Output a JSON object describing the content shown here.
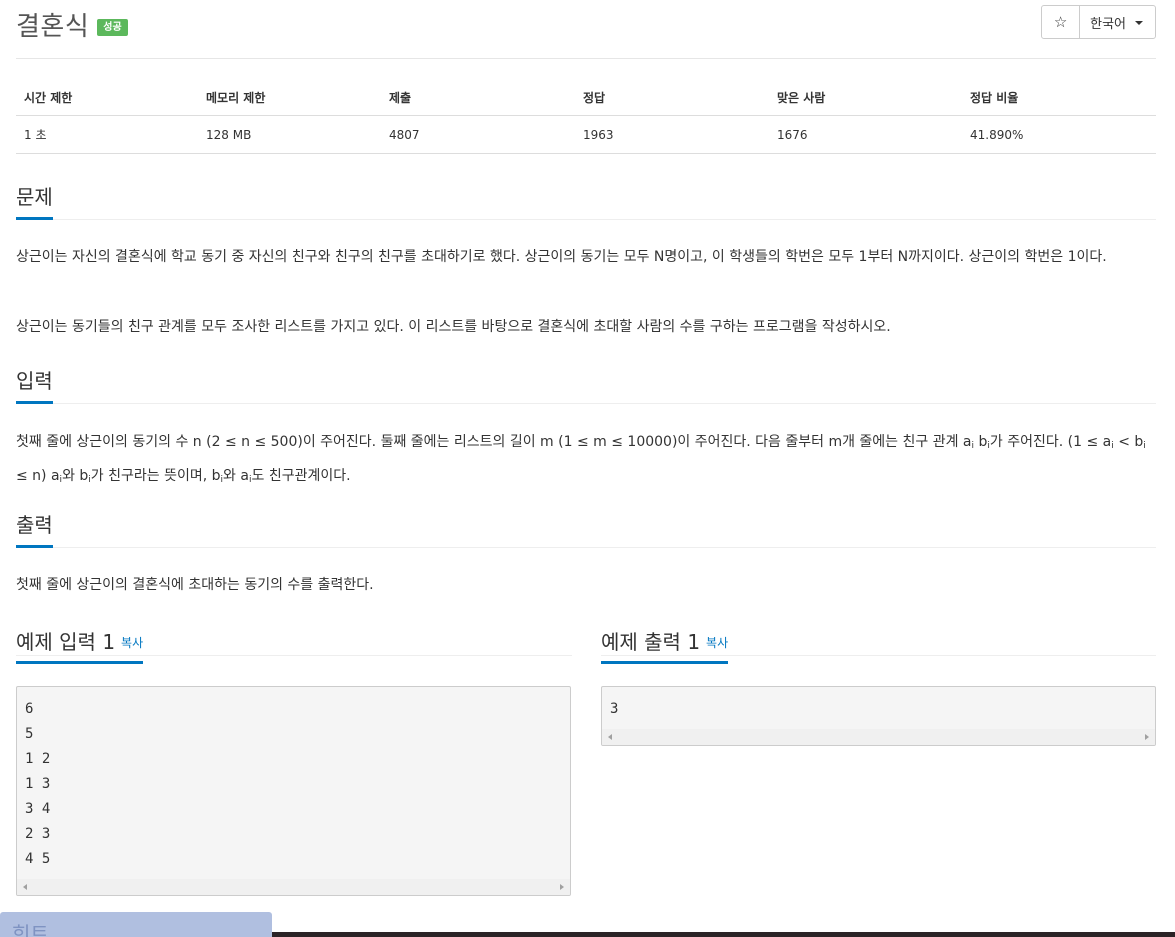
{
  "problem": {
    "title": "결혼식",
    "status_badge": "성공"
  },
  "header_controls": {
    "star_icon": "☆",
    "language_label": "한국어"
  },
  "info_table": {
    "headers": [
      "시간 제한",
      "메모리 제한",
      "제출",
      "정답",
      "맞은 사람",
      "정답 비율"
    ],
    "values": [
      "1 초",
      "128 MB",
      "4807",
      "1963",
      "1676",
      "41.890%"
    ]
  },
  "sections": {
    "problem": {
      "heading": "문제",
      "paragraphs": [
        "상근이는 자신의 결혼식에 학교 동기 중 자신의 친구와 친구의 친구를 초대하기로 했다. 상근이의 동기는 모두 N명이고, 이 학생들의 학번은 모두 1부터 N까지이다. 상근이의 학번은 1이다.",
        "상근이는 동기들의 친구 관계를 모두 조사한 리스트를 가지고 있다. 이 리스트를 바탕으로 결혼식에 초대할 사람의 수를 구하는 프로그램을 작성하시오."
      ]
    },
    "input": {
      "heading": "입력",
      "t1": "첫째 줄에 상근이의 동기의 수 n (2 ≤ n ≤ 500)이 주어진다. 둘째 줄에는 리스트의 길이 m (1 ≤ m ≤ 10000)이 주어진다. 다음 줄부터 m개 줄에는 친구 관계 a",
      "s1": "i",
      "t2": " b",
      "s2": "i",
      "t3": "가 주어진다. (1 ≤ a",
      "s3": "i",
      "t4": " < b",
      "s4": "i",
      "t5": " ≤ n) a",
      "s5": "i",
      "t6": "와 b",
      "s6": "i",
      "t7": "가 친구라는 뜻이며, b",
      "s7": "i",
      "t8": "와 a",
      "s8": "i",
      "t9": "도 친구관계이다."
    },
    "output": {
      "heading": "출력",
      "text": "첫째 줄에 상근이의 결혼식에 초대하는 동기의 수를 출력한다."
    }
  },
  "samples": {
    "input": {
      "heading": "예제 입력 1",
      "copy_label": "복사",
      "content": "6\n5\n1 2\n1 3\n3 4\n2 3\n4 5"
    },
    "output": {
      "heading": "예제 출력 1",
      "copy_label": "복사",
      "content": "3"
    }
  },
  "hint_tab": {
    "label": "힌트"
  }
}
